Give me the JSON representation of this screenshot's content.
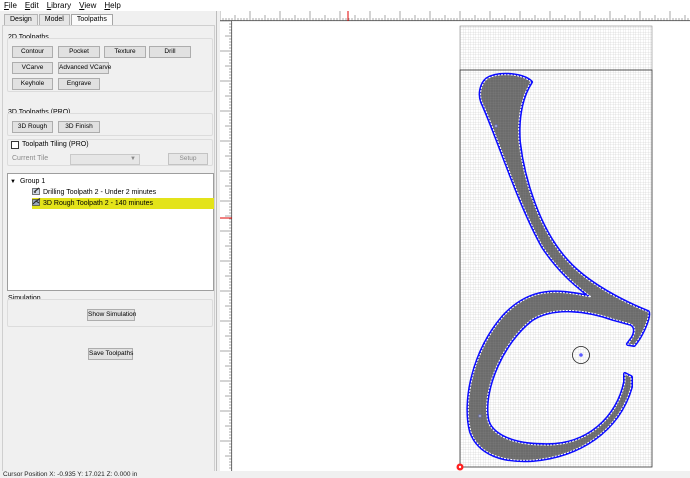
{
  "menu": [
    "File",
    "Edit",
    "Library",
    "View",
    "Help"
  ],
  "tabs": [
    {
      "label": "Design",
      "active": false
    },
    {
      "label": "Model",
      "active": false
    },
    {
      "label": "Toolpaths",
      "active": true
    }
  ],
  "toolpaths2d": {
    "title": "2D Toolpaths",
    "buttons": [
      "Contour",
      "Pocket",
      "Texture",
      "Drill",
      "VCarve",
      "Advanced VCarve",
      "Keyhole",
      "Engrave"
    ]
  },
  "toolpaths3d": {
    "title": "3D Toolpaths (PRO)",
    "buttons": [
      "3D Rough",
      "3D Finish"
    ]
  },
  "tiling": {
    "checkbox_label": "Toolpath Tiling (PRO)",
    "current_tile_label": "Current Tile",
    "setup_label": "Setup"
  },
  "tree": {
    "group": "Group 1",
    "items": [
      {
        "label": "Drilling Toolpath 2 - Under 2 minutes",
        "selected": false
      },
      {
        "label": "3D Rough Toolpath 2 - 140 minutes",
        "selected": true
      }
    ]
  },
  "simulation": {
    "title": "Simulation",
    "show_label": "Show Simulation"
  },
  "save_label": "Save Toolpaths",
  "status": "Cursor Position X: -0.935 Y: 17.021 Z: 0.000 in",
  "colors": {
    "selection": "#e3e31a",
    "toolpath": "#0000ff",
    "material": "#6b6b6b",
    "origin": "#ff0000"
  }
}
